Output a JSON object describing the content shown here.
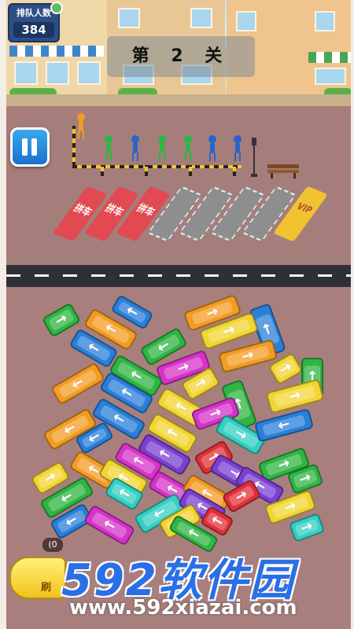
{
  "hud": {
    "queue_label": "排队人数",
    "queue_count": "384",
    "level_text": "第 2 关"
  },
  "parking": {
    "slot_label": "拼车",
    "vip_label": "VIP",
    "slots": [
      "used",
      "used",
      "used",
      "empty",
      "empty",
      "empty",
      "empty",
      "vip"
    ]
  },
  "queue_colors": [
    "#f39c24",
    "#2fb543",
    "#2a63c9",
    "#2fb543",
    "#2fb543",
    "#2a63c9",
    "#2a63c9"
  ],
  "bottom": {
    "refresh_label": "刷",
    "refresh_count": "(0"
  },
  "watermark": {
    "logo": "592软件园",
    "url": "www.592xiazai.com"
  },
  "colors": {
    "orange": "#f39c24",
    "green": "#2fb543",
    "blue": "#2a7fd8",
    "yellow": "#f2d533",
    "magenta": "#d633c9",
    "purple": "#7b3fd1",
    "cyan": "#34cfc3",
    "red": "#e0303a"
  }
}
